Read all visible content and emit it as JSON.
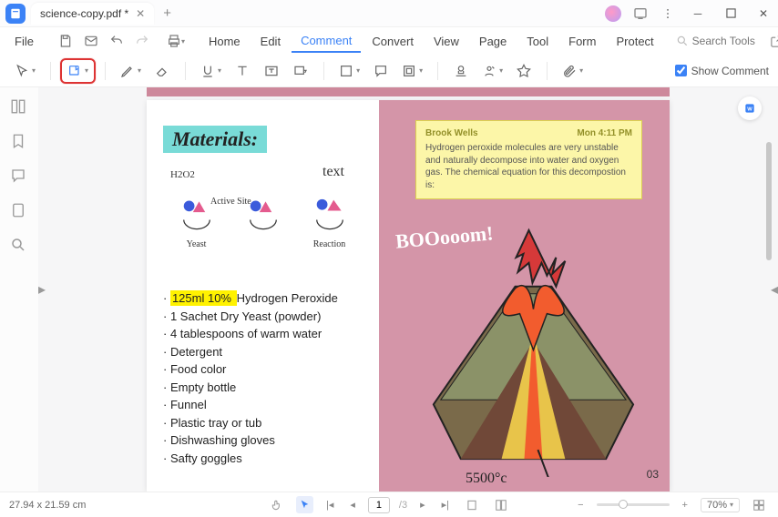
{
  "tab": {
    "title": "science-copy.pdf *"
  },
  "menu": {
    "file": "File",
    "items": [
      "Home",
      "Edit",
      "Comment",
      "Convert",
      "View",
      "Page",
      "Tool",
      "Form",
      "Protect"
    ],
    "active_index": 2,
    "search_placeholder": "Search Tools"
  },
  "toolbar": {
    "show_comment": "Show Comment"
  },
  "document": {
    "materials_title": "Materials:",
    "diagram": {
      "text_label": "text",
      "h2o2": "H2O2",
      "active_site": "Active Site",
      "items": [
        "Yeast",
        "",
        "Reaction"
      ]
    },
    "materials_list": [
      "125ml 10% Hydrogen Peroxide",
      "1 Sachet Dry Yeast (powder)",
      "4 tablespoons of warm water",
      "Detergent",
      "Food color",
      "Empty bottle",
      "Funnel",
      "Plastic tray or tub",
      "Dishwashing gloves",
      "Safty goggles"
    ],
    "highlight_prefix": "125ml 10% ",
    "highlight_rest": "Hydrogen Peroxide",
    "comment": {
      "author": "Brook Wells",
      "time": "Mon 4:11 PM",
      "body": "Hydrogen peroxide molecules are very unstable and naturally decompose into water and oxygen gas. The chemical equation for this decompostion is:"
    },
    "boom": "BOOooom!",
    "temp": "5500°c",
    "page_number": "03"
  },
  "status": {
    "dimensions": "27.94 x 21.59 cm",
    "page_current": "1",
    "page_total": "/3",
    "zoom": "70%"
  }
}
